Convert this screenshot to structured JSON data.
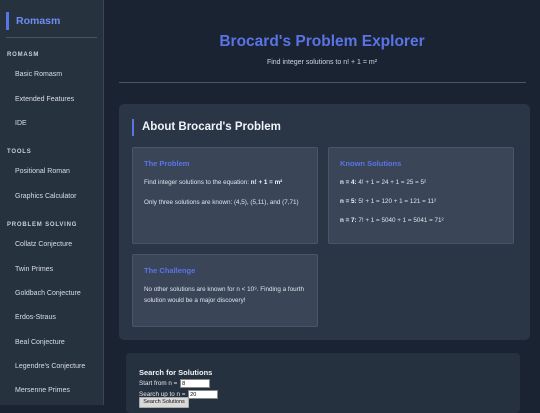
{
  "sidebar": {
    "brand": "Romasm",
    "sections": [
      {
        "title": "ROMASM",
        "items": [
          "Basic Romasm",
          "Extended Features",
          "IDE"
        ]
      },
      {
        "title": "TOOLS",
        "items": [
          "Positional Roman",
          "Graphics Calculator"
        ]
      },
      {
        "title": "PROBLEM SOLVING",
        "items": [
          "Collatz Conjecture",
          "Twin Primes",
          "Goldbach Conjecture",
          "Erdos-Straus",
          "Beal Conjecture",
          "Legendre's Conjecture",
          "Mersenne Primes"
        ]
      }
    ]
  },
  "header": {
    "title": "Brocard's Problem Explorer",
    "subtitle": "Find integer solutions to n! + 1 = m²"
  },
  "about": {
    "title": "About Brocard's Problem",
    "problem": {
      "title": "The Problem",
      "line1_prefix": "Find integer solutions to the equation: ",
      "line1_bold": "n! + 1 = m²",
      "line2": "Only three solutions are known: (4,5), (5,11), and (7,71)"
    },
    "known": {
      "title": "Known Solutions",
      "rows": [
        {
          "label": "n = 4:",
          "text": " 4! + 1 = 24 + 1 = 25 = 5²"
        },
        {
          "label": "n = 5:",
          "text": " 5! + 1 = 120 + 1 = 121 = 11²"
        },
        {
          "label": "n = 7:",
          "text": " 7! + 1 = 5040 + 1 = 5041 = 71²"
        }
      ]
    },
    "challenge": {
      "title": "The Challenge",
      "text": "No other solutions are known for n < 10⁹. Finding a fourth solution would be a major discovery!"
    }
  },
  "search": {
    "title": "Search for Solutions",
    "start_label": "Start from n =",
    "start_value": "8",
    "end_label": "Search up to n =",
    "end_value": "20",
    "button_label": "Search Solutions"
  }
}
